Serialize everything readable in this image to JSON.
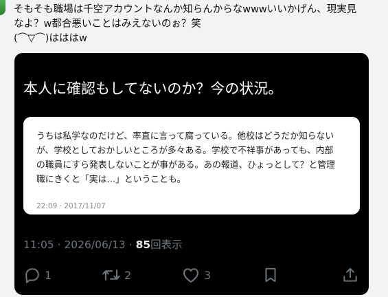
{
  "post": {
    "lines": [
      "そもそも職場は千空アカウントなんか知らんからなwwwいいかげん、現実見",
      "なよ？w都合悪いことはみえないのぉ？笑",
      "(⌒▽⌒)はははw"
    ]
  },
  "embed": {
    "title": "本人に確認もしてないのか？今の状況。",
    "quote_lines": [
      "うちは私学なのだけど、率直に言って腐っている。他校はどうだか知らない",
      "が、学校としておかしいところが多々ある。学校で不祥事があっても、内部",
      "の職員にすら発表しないことが事がある。あの報道、ひょっとして？と管理",
      "職にきくと「実は…」ということも。"
    ],
    "quote_timestamp": "22:09 · 2017/11/07",
    "meta_time": "11:05 · 2026/06/13 · ",
    "views_count": "85",
    "views_label": "回表示",
    "actions": {
      "reply_count": "1",
      "repost_count": "2",
      "like_count": "3"
    },
    "icons": [
      "reply-icon",
      "repost-icon",
      "like-icon",
      "bookmark-icon",
      "share-icon"
    ]
  },
  "colors": {
    "card_bg": "#000000",
    "meta": "#6e767d"
  }
}
